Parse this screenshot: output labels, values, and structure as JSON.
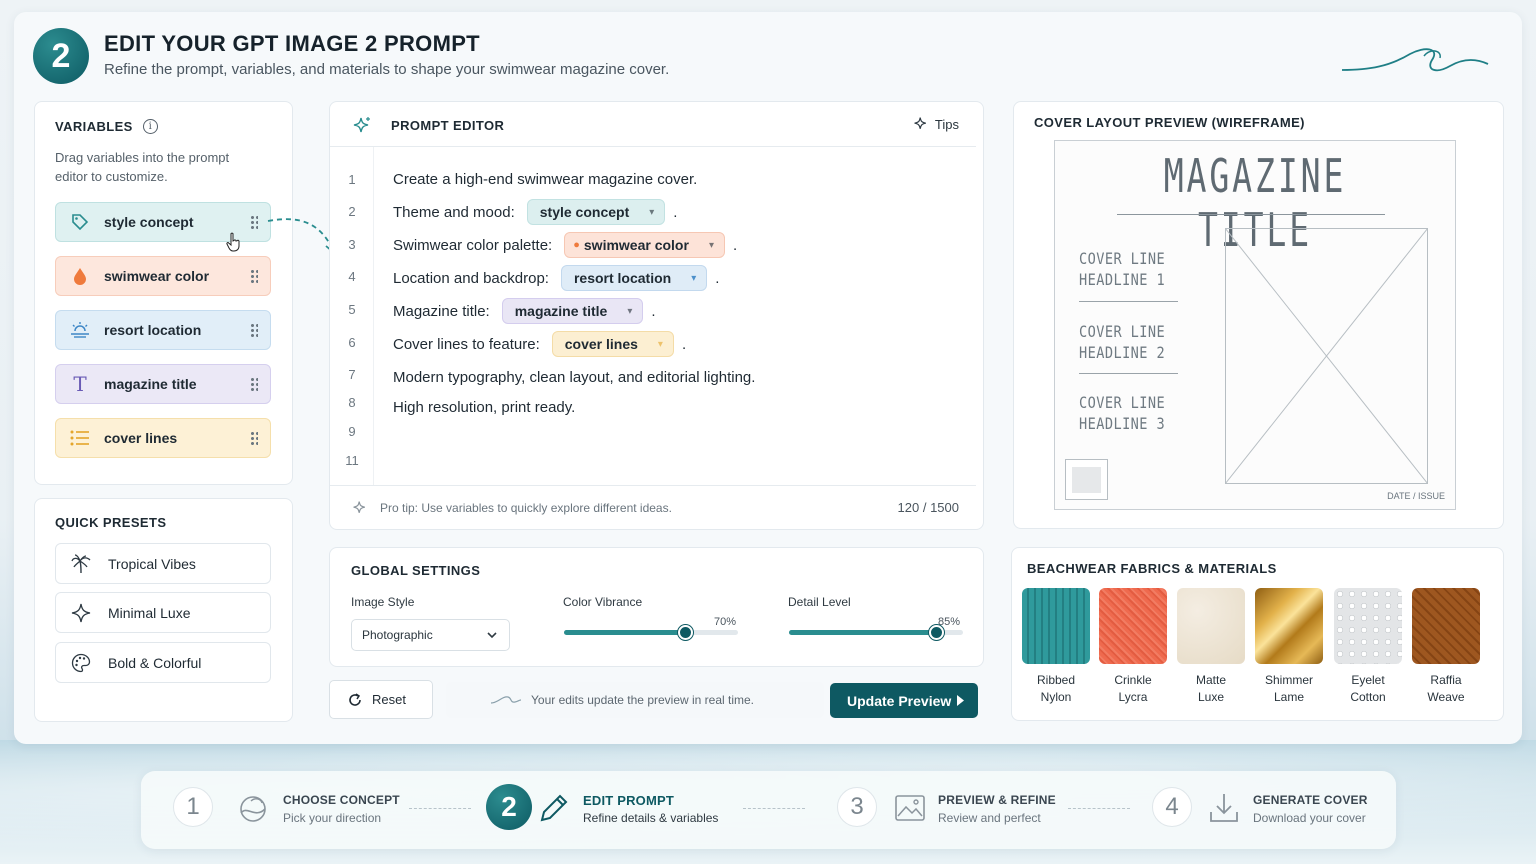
{
  "header": {
    "step_number": "2",
    "title": "EDIT YOUR GPT IMAGE 2 PROMPT",
    "subtitle": "Refine the prompt, variables, and materials to shape your swimwear magazine cover."
  },
  "variables": {
    "title": "VARIABLES",
    "description_line1": "Drag variables into the prompt",
    "description_line2": "editor to customize.",
    "items": [
      {
        "label": "style concept",
        "icon": "tag-icon",
        "color": "#dff1f1"
      },
      {
        "label": "swimwear color",
        "icon": "droplet-icon",
        "color": "#fde7dd"
      },
      {
        "label": "resort location",
        "icon": "sunrise-icon",
        "color": "#e1eef8"
      },
      {
        "label": "magazine title",
        "icon": "text-icon",
        "color": "#ebe8f6"
      },
      {
        "label": "cover lines",
        "icon": "list-icon",
        "color": "#fdf1d6"
      }
    ]
  },
  "presets": {
    "title": "QUICK PRESETS",
    "items": [
      {
        "label": "Tropical Vibes",
        "icon": "palm-tree-icon"
      },
      {
        "label": "Minimal Luxe",
        "icon": "sparkle-icon"
      },
      {
        "label": "Bold & Colorful",
        "icon": "palette-icon"
      }
    ]
  },
  "editor": {
    "title": "PROMPT EDITOR",
    "tips_label": "Tips",
    "lines": [
      {
        "num": "1",
        "text": "Create a high-end swimwear magazine cover."
      },
      {
        "num": "2",
        "text": "Theme and mood:",
        "token": "style concept",
        "end": "."
      },
      {
        "num": "3",
        "text": "Swimwear color palette:",
        "token": "swimwear color",
        "end": "."
      },
      {
        "num": "4",
        "text": "Location and backdrop:",
        "token": "resort location",
        "end": "."
      },
      {
        "num": "5",
        "text": "Magazine title:",
        "token": "magazine title",
        "end": "."
      },
      {
        "num": "6",
        "text": "Cover lines to feature:",
        "token": "cover lines",
        "end": "."
      },
      {
        "num": "7",
        "text": "Modern typography, clean layout, and editorial lighting."
      },
      {
        "num": "8",
        "text": "High resolution, print ready."
      },
      {
        "num": "9",
        "text": ""
      },
      {
        "num": "11",
        "text": ""
      }
    ],
    "tip_text": "Pro tip: Use variables to quickly explore different ideas.",
    "char_count": "120 / 1500"
  },
  "global_settings": {
    "title": "GLOBAL SETTINGS",
    "image_style_label": "Image Style",
    "image_style_value": "Photographic",
    "color_vibrance_label": "Color Vibrance",
    "color_vibrance_value": "70%",
    "color_vibrance_level": 0.7,
    "detail_level_label": "Detail Level",
    "detail_level_value": "85%",
    "detail_level_level": 0.85
  },
  "actions": {
    "reset_label": "Reset",
    "live_note": "Your edits update the preview in real time.",
    "update_label": "Update Preview"
  },
  "preview": {
    "title": "COVER LAYOUT PREVIEW (WIREFRAME)",
    "magazine_title": "MAGAZINE TITLE",
    "cover_lines": [
      {
        "line1": "COVER LINE",
        "line2": "HEADLINE 1"
      },
      {
        "line1": "COVER LINE",
        "line2": "HEADLINE 2"
      },
      {
        "line1": "COVER LINE",
        "line2": "HEADLINE 3"
      }
    ],
    "date_issue": "DATE / ISSUE"
  },
  "fabrics": {
    "title": "BEACHWEAR FABRICS & MATERIALS",
    "items": [
      {
        "line1": "Ribbed",
        "line2": "Nylon",
        "color": "#2f9a9c"
      },
      {
        "line1": "Crinkle",
        "line2": "Lycra",
        "color": "#ef6a4e"
      },
      {
        "line1": "Matte",
        "line2": "Luxe",
        "color": "#ece3d3"
      },
      {
        "line1": "Shimmer",
        "line2": "Lame",
        "color": "#c99325"
      },
      {
        "line1": "Eyelet",
        "line2": "Cotton",
        "color": "#e2e4e6"
      },
      {
        "line1": "Raffia",
        "line2": "Weave",
        "color": "#c9955a"
      }
    ]
  },
  "stepper": {
    "steps": [
      {
        "num": "1",
        "title": "CHOOSE CONCEPT",
        "sub": "Pick your direction",
        "icon": "concept-icon"
      },
      {
        "num": "2",
        "title": "EDIT PROMPT",
        "sub": "Refine details & variables",
        "icon": "pencil-icon"
      },
      {
        "num": "3",
        "title": "PREVIEW & REFINE",
        "sub": "Review and perfect",
        "icon": "image-icon"
      },
      {
        "num": "4",
        "title": "GENERATE COVER",
        "sub": "Download your cover",
        "icon": "download-icon"
      }
    ]
  },
  "colors": {
    "accent": "#0e5962",
    "accent_light": "#2a8d8f"
  }
}
